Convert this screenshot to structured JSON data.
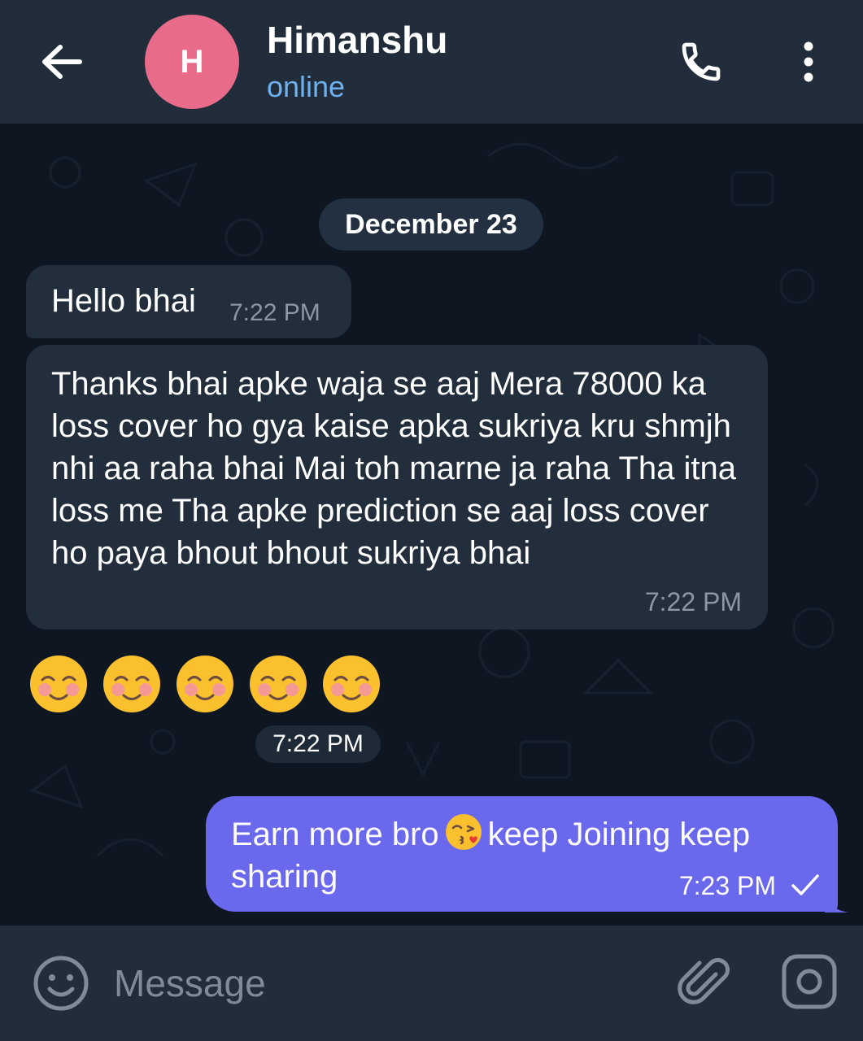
{
  "header": {
    "avatar_initial": "H",
    "avatar_color": "#e86b8a",
    "contact_name": "Himanshu",
    "status": "online",
    "back_icon": "arrow-left-icon",
    "call_icon": "phone-icon",
    "menu_icon": "more-vertical-icon"
  },
  "chat": {
    "date_separator": "December 23",
    "messages": [
      {
        "direction": "incoming",
        "text": "Hello bhai",
        "time": "7:22 PM"
      },
      {
        "direction": "incoming",
        "text": "Thanks bhai apke waja se aaj Mera 78000 ka loss cover ho gya kaise apka sukriya kru shmjh nhi aa raha bhai Mai toh marne ja raha Tha itna loss me Tha apke prediction se aaj loss cover ho paya bhout bhout sukriya bhai",
        "time": "7:22 PM"
      },
      {
        "direction": "incoming",
        "type": "emoji",
        "emojis": [
          "☺️",
          "☺️",
          "☺️",
          "☺️",
          "☺️"
        ],
        "time": "7:22 PM"
      },
      {
        "direction": "outgoing",
        "text_before_emoji": "Earn more bro",
        "emoji": "😘",
        "text_after_emoji": "keep Joining keep sharing",
        "time": "7:23 PM",
        "status_icon": "check-icon"
      }
    ]
  },
  "input_bar": {
    "placeholder": "Message",
    "emoji_icon": "smile-icon",
    "attach_icon": "paperclip-icon",
    "camera_icon": "camera-icon"
  },
  "colors": {
    "header_bg": "#212d3b",
    "chat_bg": "#0e1621",
    "incoming_bubble": "#222e3c",
    "outgoing_bubble": "#6a68ec",
    "status_online": "#6fb1ef"
  }
}
